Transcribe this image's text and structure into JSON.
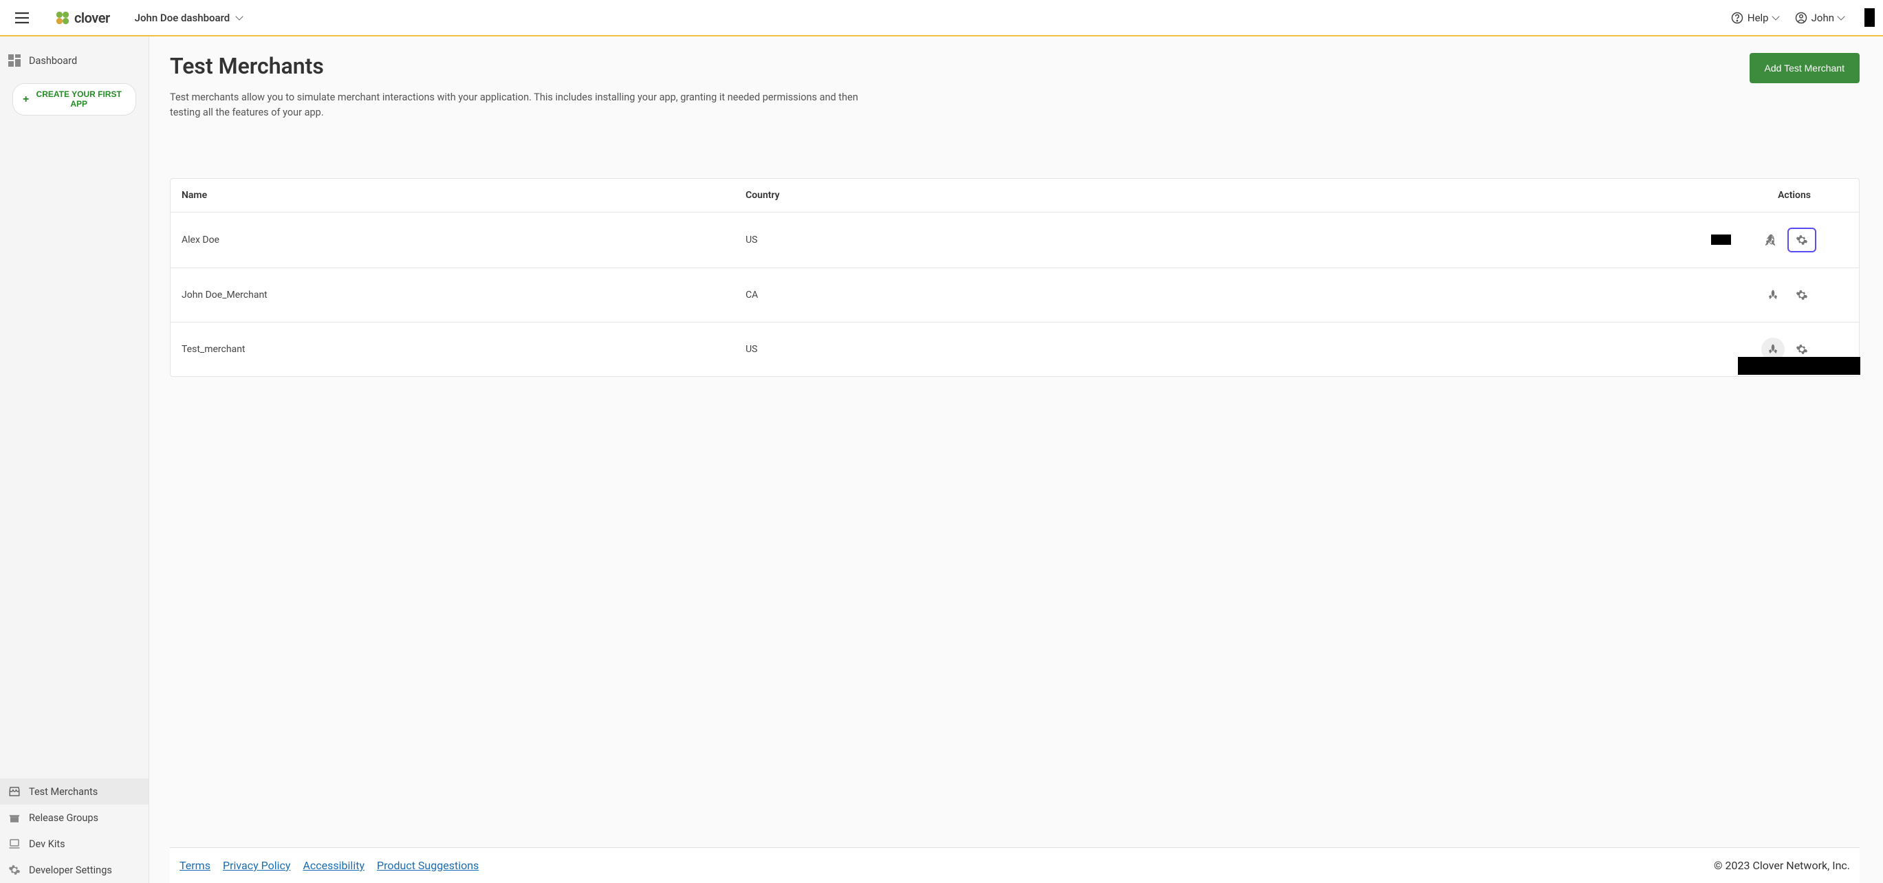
{
  "header": {
    "dashboard_name": "John Doe dashboard",
    "help_label": "Help",
    "user_name": "John"
  },
  "logo": {
    "text": "clover"
  },
  "sidebar": {
    "dashboard": "Dashboard",
    "create_app": "CREATE YOUR FIRST APP",
    "test_merchants": "Test Merchants",
    "release_groups": "Release Groups",
    "dev_kits": "Dev Kits",
    "developer_settings": "Developer Settings"
  },
  "page": {
    "title": "Test Merchants",
    "add_button": "Add Test Merchant",
    "description": "Test merchants allow you to simulate merchant interactions with your application. This includes installing your app, granting it needed permissions and then testing all the features of your app."
  },
  "table": {
    "columns": {
      "name": "Name",
      "country": "Country",
      "actions": "Actions"
    },
    "rows": [
      {
        "name": "Alex Doe",
        "country": "US"
      },
      {
        "name": "John Doe_Merchant",
        "country": "CA"
      },
      {
        "name": "Test_merchant",
        "country": "US"
      }
    ]
  },
  "footer": {
    "links": {
      "terms": "Terms",
      "privacy": "Privacy Policy",
      "accessibility": "Accessibility",
      "suggestions": "Product Suggestions"
    },
    "copyright": "© 2023 Clover Network, Inc."
  }
}
